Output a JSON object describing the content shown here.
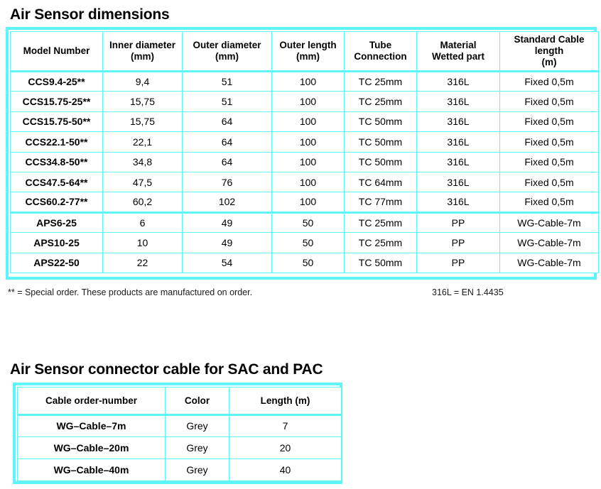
{
  "theme": {
    "accent_border": "#5ef4fb",
    "text": "#000000",
    "background": "#ffffff"
  },
  "dimensions_section": {
    "title": "Air Sensor dimensions",
    "columns": [
      "Model Number",
      "Inner diameter\n(mm)",
      "Outer diameter\n(mm)",
      "Outer length\n(mm)",
      "Tube\nConnection",
      "Material\nWetted part",
      "Standard Cable\nlength\n(m)"
    ],
    "columns_split": [
      {
        "line1": "Model Number",
        "line2": "",
        "line3": ""
      },
      {
        "line1": "Inner diameter",
        "line2": "(mm)",
        "line3": ""
      },
      {
        "line1": "Outer diameter",
        "line2": "(mm)",
        "line3": ""
      },
      {
        "line1": "Outer length",
        "line2": "(mm)",
        "line3": ""
      },
      {
        "line1": "Tube",
        "line2": "Connection",
        "line3": ""
      },
      {
        "line1": "Material",
        "line2": "Wetted part",
        "line3": ""
      },
      {
        "line1": "Standard Cable",
        "line2": "length",
        "line3": "(m)"
      }
    ],
    "rows": [
      {
        "model": "CCS9.4-25**",
        "inner_diameter": "9,4",
        "outer_diameter": "51",
        "outer_length": "100",
        "tube_connection": "TC 25mm",
        "material": "316L",
        "cable_length": "Fixed 0,5m",
        "group": "ccs"
      },
      {
        "model": "CCS15.75-25**",
        "inner_diameter": "15,75",
        "outer_diameter": "51",
        "outer_length": "100",
        "tube_connection": "TC 25mm",
        "material": "316L",
        "cable_length": "Fixed 0,5m",
        "group": "ccs"
      },
      {
        "model": "CCS15.75-50**",
        "inner_diameter": "15,75",
        "outer_diameter": "64",
        "outer_length": "100",
        "tube_connection": "TC 50mm",
        "material": "316L",
        "cable_length": "Fixed 0,5m",
        "group": "ccs"
      },
      {
        "model": "CCS22.1-50**",
        "inner_diameter": "22,1",
        "outer_diameter": "64",
        "outer_length": "100",
        "tube_connection": "TC 50mm",
        "material": "316L",
        "cable_length": "Fixed 0,5m",
        "group": "ccs"
      },
      {
        "model": "CCS34.8-50**",
        "inner_diameter": "34,8",
        "outer_diameter": "64",
        "outer_length": "100",
        "tube_connection": "TC 50mm",
        "material": "316L",
        "cable_length": "Fixed 0,5m",
        "group": "ccs"
      },
      {
        "model": "CCS47.5-64**",
        "inner_diameter": "47,5",
        "outer_diameter": "76",
        "outer_length": "100",
        "tube_connection": "TC 64mm",
        "material": "316L",
        "cable_length": "Fixed 0,5m",
        "group": "ccs"
      },
      {
        "model": "CCS60.2-77**",
        "inner_diameter": "60,2",
        "outer_diameter": "102",
        "outer_length": "100",
        "tube_connection": "TC 77mm",
        "material": "316L",
        "cable_length": "Fixed 0,5m",
        "group": "ccs"
      },
      {
        "model": "APS6-25",
        "inner_diameter": "6",
        "outer_diameter": "49",
        "outer_length": "50",
        "tube_connection": "TC 25mm",
        "material": "PP",
        "cable_length": "WG-Cable-7m",
        "group": "aps"
      },
      {
        "model": "APS10-25",
        "inner_diameter": "10",
        "outer_diameter": "49",
        "outer_length": "50",
        "tube_connection": "TC 25mm",
        "material": "PP",
        "cable_length": "WG-Cable-7m",
        "group": "aps"
      },
      {
        "model": "APS22-50",
        "inner_diameter": "22",
        "outer_diameter": "54",
        "outer_length": "50",
        "tube_connection": "TC 50mm",
        "material": "PP",
        "cable_length": "WG-Cable-7m",
        "group": "aps"
      }
    ]
  },
  "footnotes": {
    "special_order": "** = Special order. These products are manufactured on order.",
    "material_standard": "316L = EN 1.4435"
  },
  "connector_section": {
    "title": "Air Sensor connector cable for SAC and PAC",
    "columns": [
      "Cable order-number",
      "Color",
      "Length (m)"
    ],
    "rows": [
      {
        "cable": "WG–Cable–7m",
        "color": "Grey",
        "length": "7"
      },
      {
        "cable": "WG–Cable–20m",
        "color": "Grey",
        "length": "20"
      },
      {
        "cable": "WG–Cable–40m",
        "color": "Grey",
        "length": "40"
      }
    ]
  }
}
